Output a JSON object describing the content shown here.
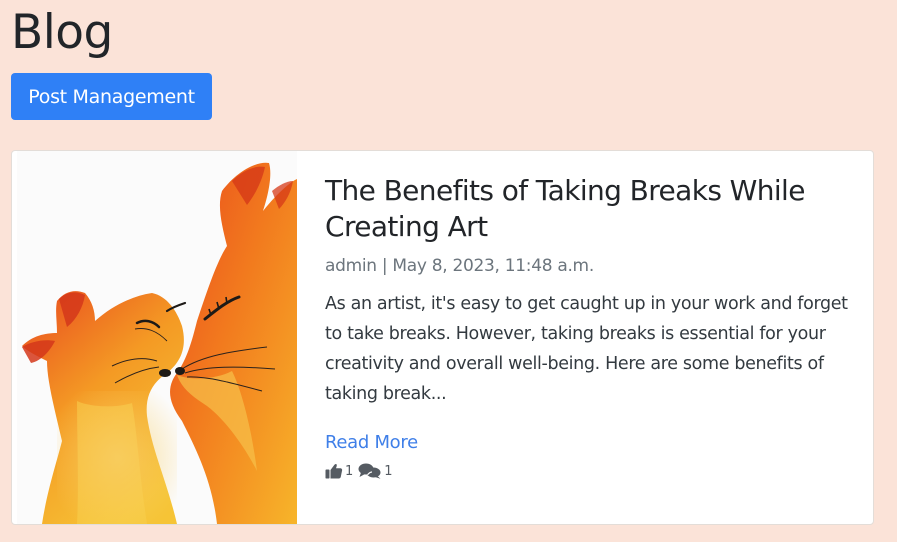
{
  "header": {
    "title": "Blog",
    "post_management_label": "Post Management"
  },
  "post": {
    "title": "The Benefits of Taking Breaks While Creating Art",
    "author": "admin",
    "separator": "|",
    "date": "May 8, 2023, 11:48 a.m.",
    "meta": "admin | May 8, 2023, 11:48 a.m.",
    "excerpt": "As an artist, it's easy to get caught up in your work and forget to take breaks. However, taking breaks is essential for your creativity and overall well-being. Here are some benefits of taking break...",
    "read_more_label": "Read More",
    "likes": "1",
    "comments": "1",
    "thumbnail_icon": "watercolor-foxes-image"
  },
  "colors": {
    "background": "#fbe3d8",
    "primary": "#2f80f6",
    "link": "#3f7fe8",
    "card": "#ffffff"
  },
  "icons": {
    "like": "thumbs-up-icon",
    "comment": "comments-icon"
  }
}
